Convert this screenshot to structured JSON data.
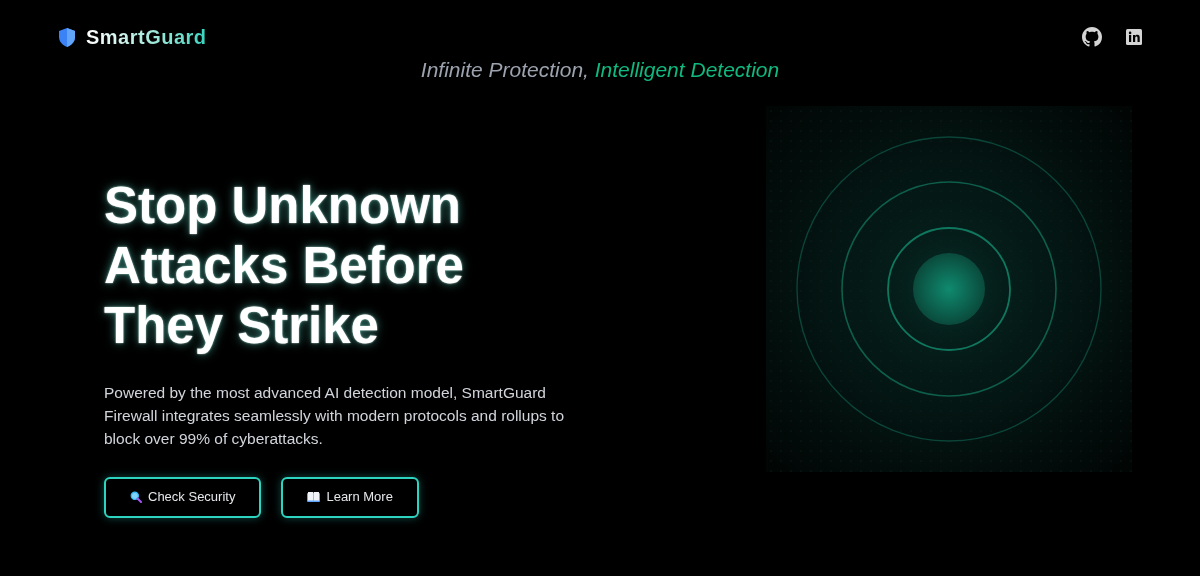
{
  "brand": {
    "name": "SmartGuard"
  },
  "tagline": [
    {
      "kind": "plain",
      "text": "Infinite Protection, "
    },
    {
      "kind": "accent",
      "text": "Intelligent Detection"
    }
  ],
  "hero": {
    "headline": [
      "Stop Unknown",
      "Attacks Before",
      "They Strike"
    ],
    "description": "Powered by the most advanced AI detection model, SmartGuard Firewall integrates seamlessly with modern protocols and rollups to block over 99% of cyberattacks.",
    "buttons": [
      {
        "kind": "search",
        "label": "Check Security"
      },
      {
        "kind": "book",
        "label": "Learn More"
      }
    ]
  }
}
